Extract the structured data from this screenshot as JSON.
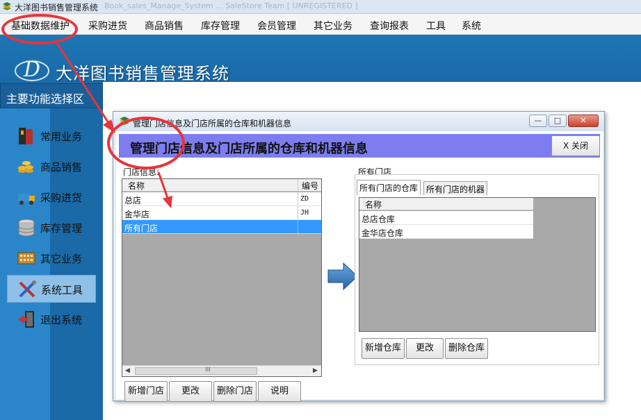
{
  "window": {
    "title": "大洋图书销售管理系统",
    "blurred_title": "Book_sales_Manage_System ... SaleStore Team [ UNREGISTERED ]"
  },
  "menu": [
    {
      "label": "基础数据维护"
    },
    {
      "label": "采购进货"
    },
    {
      "label": "商品销售"
    },
    {
      "label": "库存管理"
    },
    {
      "label": "会员管理"
    },
    {
      "label": "其它业务"
    },
    {
      "label": "查询报表"
    },
    {
      "label": "工具"
    },
    {
      "label": "系统"
    }
  ],
  "banner": {
    "title": "大洋图书销售管理系统"
  },
  "sidebar": {
    "title": "主要功能选择区",
    "items": [
      {
        "label": "常用业务",
        "icon": "book-icon"
      },
      {
        "label": "商品销售",
        "icon": "coins-icon"
      },
      {
        "label": "采购进货",
        "icon": "truck-icon"
      },
      {
        "label": "库存管理",
        "icon": "database-icon"
      },
      {
        "label": "其它业务",
        "icon": "calculator-icon"
      },
      {
        "label": "系统工具",
        "icon": "tools-icon",
        "active": true
      },
      {
        "label": "退出系统",
        "icon": "exit-icon"
      }
    ]
  },
  "dialog": {
    "title": "管理门店信息及门店所属的仓库和机器信息",
    "header": "管理门店信息及门店所属的仓库和机器信息",
    "close_button": "X 关闭",
    "window_buttons": {
      "minimize": "—",
      "maximize": "□",
      "close": "✕"
    },
    "stores": {
      "label": "门店信息:",
      "columns": [
        "名称",
        "编号"
      ],
      "rows": [
        {
          "name": "总店",
          "code": "ZD"
        },
        {
          "name": "金华店",
          "code": "JH"
        },
        {
          "name": "所有门店",
          "code": "",
          "selected": true
        }
      ],
      "scroll_grip": "III",
      "buttons": [
        "新增门店",
        "更改",
        "删除门店",
        "说明"
      ]
    },
    "right": {
      "label": "所有门店",
      "tabs": [
        "所有门店的仓库",
        "所有门店的机器"
      ],
      "active_tab": 0,
      "columns": [
        "名称"
      ],
      "rows": [
        "总店仓库",
        "金华店仓库"
      ],
      "buttons": [
        "新增仓库",
        "更改",
        "删除仓库"
      ]
    }
  },
  "colors": {
    "banner": "#1a6aa8",
    "dialog_header": "#7d7df0",
    "selected_row": "#3399ff",
    "annotation": "#e8343a"
  }
}
